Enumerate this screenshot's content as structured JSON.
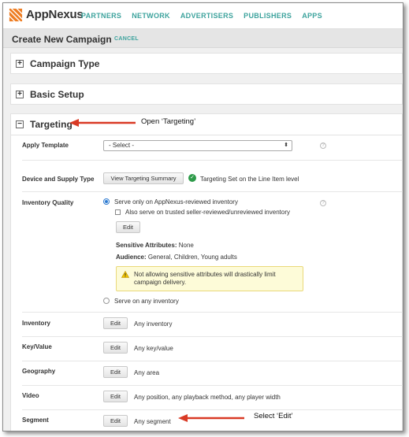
{
  "app": {
    "name": "AppNexus"
  },
  "nav": {
    "items": [
      "PARTNERS",
      "NETWORK",
      "ADVERTISERS",
      "PUBLISHERS",
      "APPS"
    ]
  },
  "page": {
    "title": "Create New Campaign",
    "cancel": "CANCEL"
  },
  "sections": {
    "campaign_type": {
      "title": "Campaign Type",
      "toggle": "+"
    },
    "basic_setup": {
      "title": "Basic Setup",
      "toggle": "+"
    },
    "targeting": {
      "title": "Targeting",
      "toggle": "−"
    }
  },
  "targeting": {
    "apply_template": {
      "label": "Apply Template",
      "selected": "- Select -"
    },
    "device_supply": {
      "label": "Device and Supply Type",
      "button": "View Targeting Summary",
      "status": "Targeting Set on the Line Item level"
    },
    "inventory_quality": {
      "label": "Inventory Quality",
      "option1": "Serve only on AppNexus-reviewed inventory",
      "option1_checked": true,
      "checkbox": "Also serve on trusted seller-reviewed/unreviewed inventory",
      "checkbox_checked": false,
      "edit": "Edit",
      "sensitive_label": "Sensitive Attributes:",
      "sensitive_value": "None",
      "audience_label": "Audience:",
      "audience_value": "General, Children, Young adults",
      "warning_line1": "Not allowing sensitive attributes will drastically limit",
      "warning_line2": "campaign delivery.",
      "option2": "Serve on any inventory",
      "option2_checked": false
    },
    "rows": [
      {
        "label": "Inventory",
        "edit": "Edit",
        "value": "Any inventory"
      },
      {
        "label": "Key/Value",
        "edit": "Edit",
        "value": "Any key/value"
      },
      {
        "label": "Geography",
        "edit": "Edit",
        "value": "Any area"
      },
      {
        "label": "Video",
        "edit": "Edit",
        "value": "Any position, any playback method, any player width"
      },
      {
        "label": "Segment",
        "edit": "Edit",
        "value": "Any segment"
      }
    ]
  },
  "annotations": {
    "open_targeting": "Open ‘Targeting’",
    "select_edit": "Select ‘Edit’",
    "arrow_color": "#d93a25"
  },
  "colors": {
    "accent": "#3da39d",
    "logo_orange": "#ee7d22"
  },
  "icons": {
    "help": "?",
    "check": "✓",
    "select_caret": "⬍"
  }
}
